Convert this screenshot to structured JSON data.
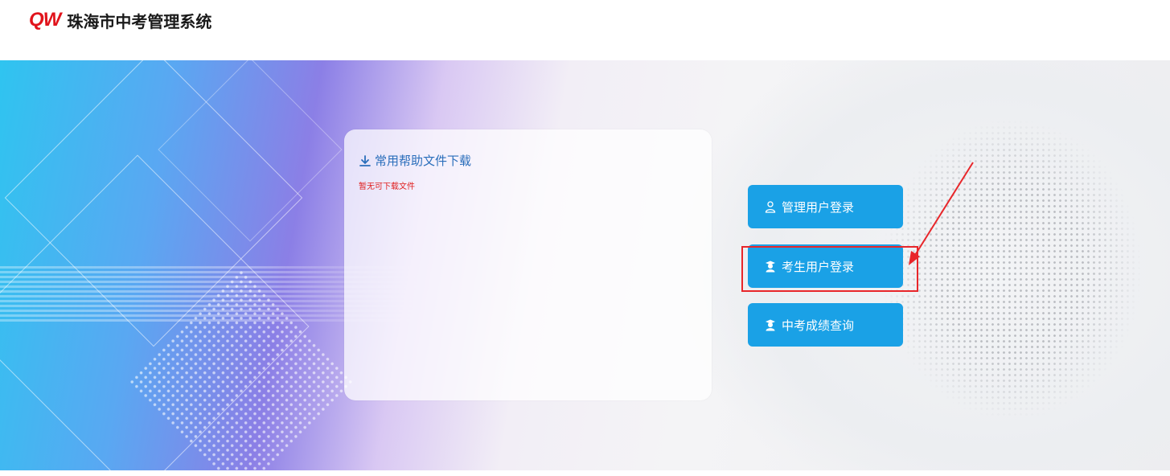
{
  "header": {
    "logo_mark": "QW",
    "title": "珠海市中考管理系统"
  },
  "help": {
    "title": "常用帮助文件下载",
    "empty_text": "暂无可下载文件",
    "icon": "download-icon"
  },
  "buttons": [
    {
      "label": "管理用户登录",
      "icon": "admin-user-icon"
    },
    {
      "label": "考生用户登录",
      "icon": "student-user-icon"
    },
    {
      "label": "中考成绩查询",
      "icon": "student-user-icon"
    }
  ],
  "colors": {
    "brand_red": "#e1141c",
    "button_blue": "#1aa1e6",
    "link_blue": "#2a6ebb",
    "empty_red": "#e02020",
    "highlight_red": "#e8262a"
  }
}
